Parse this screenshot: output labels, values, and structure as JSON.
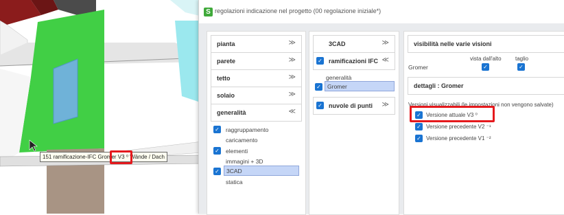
{
  "scene": {
    "tooltip": "151 ramificazione-IFC Gromer V3 ⁰ Wände / Dach"
  },
  "dialog": {
    "title": "regolazioni indicazione nel progetto  (00 regolazione iniziale*)"
  },
  "col1": {
    "headers": [
      {
        "label": "pianta",
        "chevron": "≫"
      },
      {
        "label": "parete",
        "chevron": "≫"
      },
      {
        "label": "tetto",
        "chevron": "≫"
      },
      {
        "label": "solaio",
        "chevron": "≫"
      },
      {
        "label": "generalità",
        "chevron": "≪"
      }
    ],
    "items": [
      "raggruppamento",
      "caricamento",
      "elementi",
      "immagini + 3D",
      "3CAD",
      "statica"
    ]
  },
  "col2": {
    "headers": [
      {
        "label": "3CAD",
        "chevron": "≫"
      },
      {
        "label": "ramificazioni IFC",
        "chevron": "≪"
      },
      {
        "label": "nuvole di punti",
        "chevron": "≫"
      }
    ],
    "items": [
      "generalità",
      "Gromer"
    ]
  },
  "col3": {
    "visibility_header": "visibilità nelle varie visioni",
    "col_top": "vista dall'alto",
    "col_cut": "taglio",
    "row_label": "Gromer",
    "details_header": "dettagli : Gromer",
    "versions_note": "Versioni visualizzabili (le impostazioni non vengono salvate)",
    "versions": [
      "Versione attuale V3 ⁰",
      "Versione precedente V2 ⁻¹",
      "Versione precedente V1 ⁻²"
    ]
  },
  "colors": {
    "accent": "#1a74d2",
    "highlight": "#e5191d",
    "selection": "#c5d6f7",
    "wall_green": "#41cf45",
    "glass": "#6fb2d8"
  }
}
